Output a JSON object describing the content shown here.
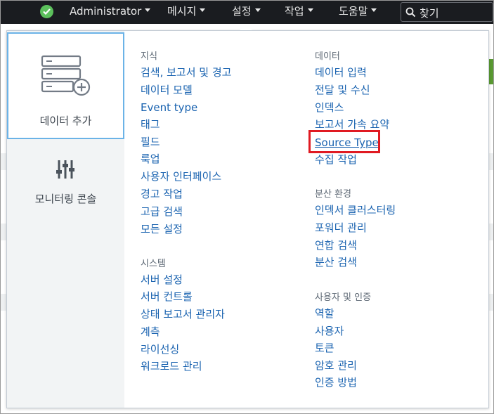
{
  "topbar": {
    "user": "Administrator",
    "items": [
      "메시지",
      "설정",
      "작업",
      "도움말"
    ],
    "search_label": "찾기"
  },
  "side": {
    "add_data_label": "데이터 추가",
    "monitoring_label": "모니터링 콘솔"
  },
  "knowledge": {
    "heading": "지식",
    "items": [
      "검색, 보고서 및 경고",
      "데이터 모델",
      "Event type",
      "태그",
      "필드",
      "룩업",
      "사용자 인터페이스",
      "경고 작업",
      "고급 검색",
      "모든 설정"
    ]
  },
  "system": {
    "heading": "시스템",
    "items": [
      "서버 설정",
      "서버 컨트롤",
      "상태 보고서 관리자",
      "계측",
      "라이선싱",
      "워크로드 관리"
    ]
  },
  "data": {
    "heading": "데이터",
    "items": [
      "데이터 입력",
      "전달 및 수신",
      "인덱스",
      "보고서 가속 요약",
      "Source Type",
      "수집 작업"
    ]
  },
  "distributed": {
    "heading": "분산 환경",
    "items": [
      "인덱서 클러스터링",
      "포워더 관리",
      "연합 검색",
      "분산 검색"
    ]
  },
  "users_auth": {
    "heading": "사용자 및 인증",
    "items": [
      "역할",
      "사용자",
      "토큰",
      "암호 관리",
      "인증 방법"
    ]
  },
  "colors": {
    "topbar_bg": "#1a1c20",
    "link": "#1a63b0",
    "status_ok": "#5cc05c",
    "highlight_box": "#e01a22",
    "tile_border": "#6bb3e7"
  },
  "icons": {
    "status": "check-circle-icon",
    "search": "magnifier-icon",
    "add_data": "server-stack-plus-icon",
    "monitoring": "sliders-icon"
  }
}
